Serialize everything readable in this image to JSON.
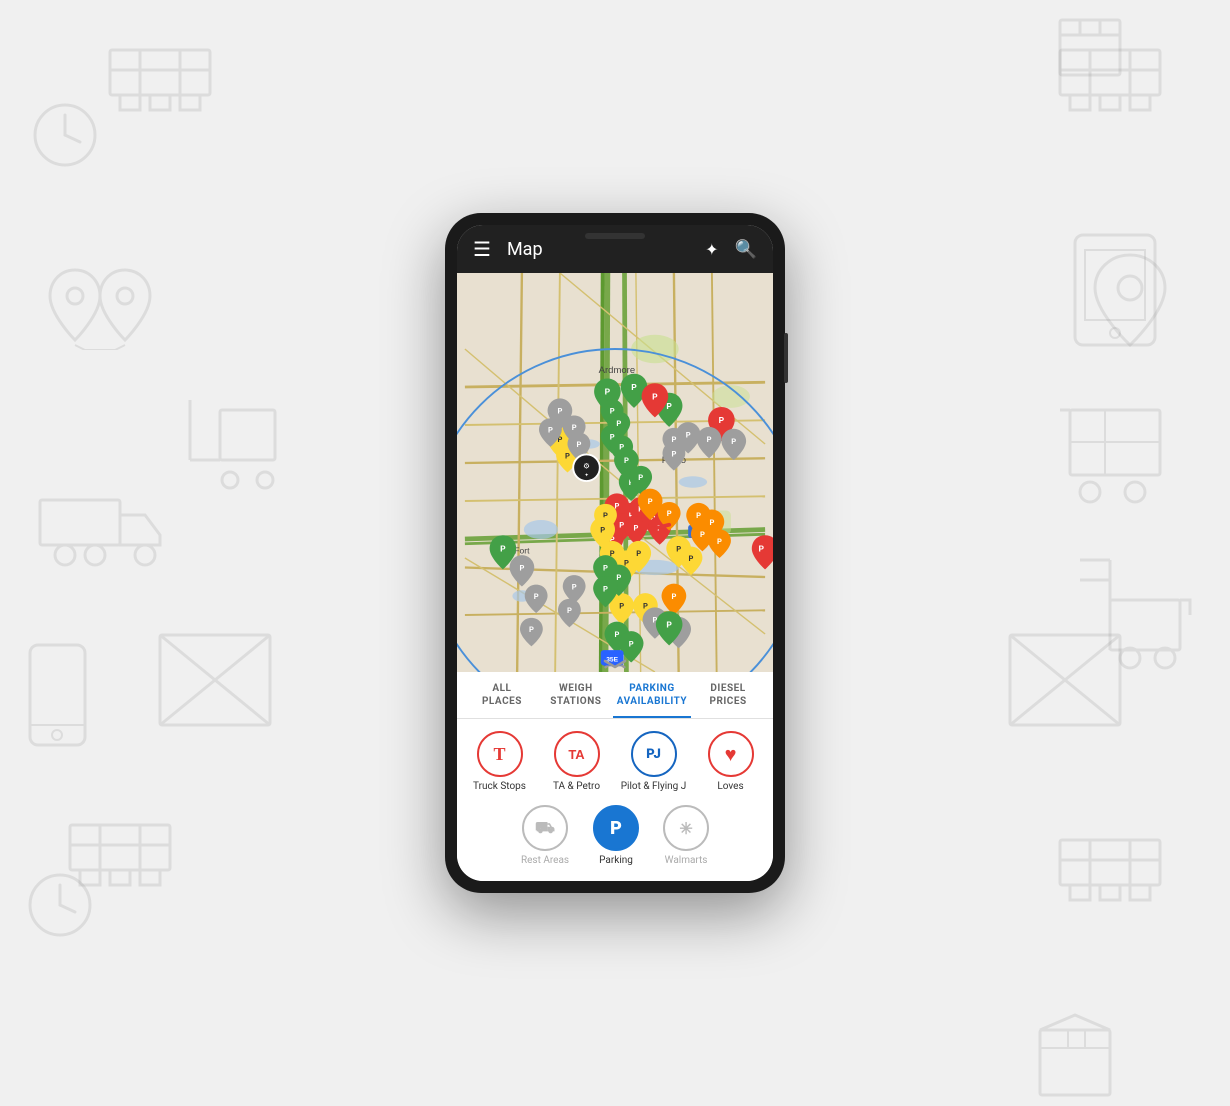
{
  "background": {
    "color": "#f0f0f0"
  },
  "phone": {
    "header": {
      "title": "Map",
      "menu_icon": "☰",
      "location_icon": "✦",
      "search_icon": "🔍"
    },
    "tabs": [
      {
        "id": "all-places",
        "label": "ALL\nPLACES",
        "active": false
      },
      {
        "id": "weigh-stations",
        "label": "WEIGH\nSTATIONS",
        "active": false
      },
      {
        "id": "parking-availability",
        "label": "PARKING\nAVAILABILITY",
        "active": true
      },
      {
        "id": "diesel-prices",
        "label": "DIESEL\nPRICES",
        "active": false
      }
    ],
    "filters": [
      {
        "id": "truck-stops",
        "label": "Truck Stops",
        "symbol": "T",
        "style": "truck-stops",
        "active": true,
        "row": 1
      },
      {
        "id": "ta-petro",
        "label": "TA & Petro",
        "symbol": "TA",
        "style": "ta-petro",
        "active": true,
        "row": 1
      },
      {
        "id": "pilot-flying-j",
        "label": "Pilot & Flying J",
        "symbol": "PJ",
        "style": "pilot",
        "active": true,
        "row": 1
      },
      {
        "id": "loves",
        "label": "Loves",
        "symbol": "♥",
        "style": "loves",
        "active": true,
        "row": 1
      },
      {
        "id": "rest-areas",
        "label": "Rest Areas",
        "symbol": "⛟",
        "style": "rest",
        "active": false,
        "row": 2
      },
      {
        "id": "parking",
        "label": "Parking",
        "symbol": "P",
        "style": "parking",
        "active": true,
        "row": 2
      },
      {
        "id": "walmarts",
        "label": "Walmarts",
        "symbol": "✳",
        "style": "walmart",
        "active": false,
        "row": 2
      }
    ],
    "map": {
      "city_label": "Ardmore",
      "city2_label": "Plano",
      "city3_label": "Fort"
    }
  }
}
